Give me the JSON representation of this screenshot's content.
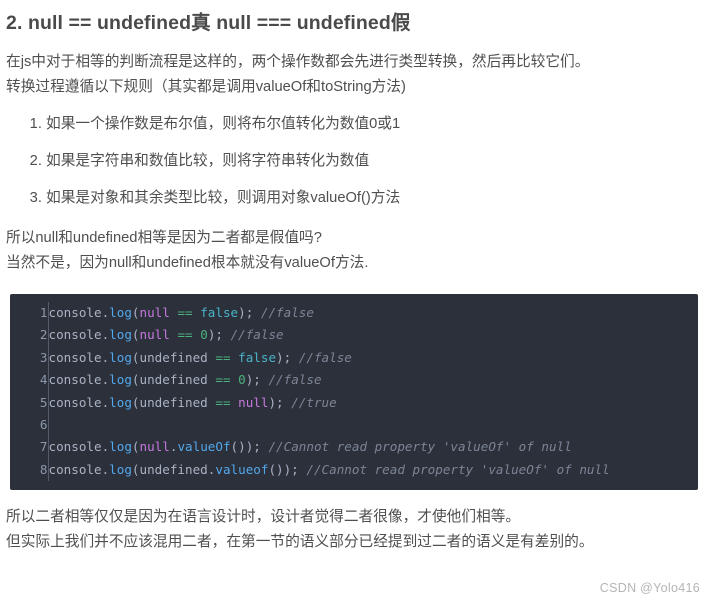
{
  "article": {
    "title": "2. null == undefined真 null === undefined假",
    "intro": [
      "在js中对于相等的判断流程是这样的，两个操作数都会先进行类型转换，然后再比较它们。",
      "转换过程遵循以下规则（其实都是调用valueOf和toString方法)"
    ],
    "rules": [
      "如果一个操作数是布尔值，则将布尔值转化为数值0或1",
      "如果是字符串和数值比较，则将字符串转化为数值",
      "如果是对象和其余类型比较，则调用对象valueOf()方法"
    ],
    "midtext": [
      "所以null和undefined相等是因为二者都是假值吗?",
      "当然不是，因为null和undefined根本就没有valueOf方法."
    ],
    "outro": [
      "所以二者相等仅仅是因为在语言设计时，设计者觉得二者很像，才使他们相等。",
      "但实际上我们并不应该混用二者，在第一节的语义部分已经提到过二者的语义是有差别的。"
    ]
  },
  "code_block": {
    "language": "javascript",
    "line_numbers": [
      "1",
      "2",
      "3",
      "4",
      "5",
      "6",
      "7",
      "8"
    ],
    "lines": [
      "console.log(null == false); //false",
      "console.log(null == 0); //false",
      "console.log(undefined == false); //false",
      "console.log(undefined == 0); //false",
      "console.log(undefined == null); //true",
      "",
      "console.log(null.valueOf()); //Cannot read property 'valueOf' of null",
      "console.log(undefined.valueof()); //Cannot read property 'valueOf' of null"
    ],
    "tokens": [
      [
        {
          "t": "console",
          "c": "t-plain"
        },
        {
          "t": ".",
          "c": "t-punc"
        },
        {
          "t": "log",
          "c": "t-fn"
        },
        {
          "t": "(",
          "c": "t-punc"
        },
        {
          "t": "null",
          "c": "t-kw"
        },
        {
          "t": " ",
          "c": "t-plain"
        },
        {
          "t": "==",
          "c": "t-op"
        },
        {
          "t": " ",
          "c": "t-plain"
        },
        {
          "t": "false",
          "c": "t-bool"
        },
        {
          "t": "); ",
          "c": "t-punc"
        },
        {
          "t": "//false",
          "c": "t-com"
        }
      ],
      [
        {
          "t": "console",
          "c": "t-plain"
        },
        {
          "t": ".",
          "c": "t-punc"
        },
        {
          "t": "log",
          "c": "t-fn"
        },
        {
          "t": "(",
          "c": "t-punc"
        },
        {
          "t": "null",
          "c": "t-kw"
        },
        {
          "t": " ",
          "c": "t-plain"
        },
        {
          "t": "==",
          "c": "t-op"
        },
        {
          "t": " ",
          "c": "t-plain"
        },
        {
          "t": "0",
          "c": "t-num"
        },
        {
          "t": "); ",
          "c": "t-punc"
        },
        {
          "t": "//false",
          "c": "t-com"
        }
      ],
      [
        {
          "t": "console",
          "c": "t-plain"
        },
        {
          "t": ".",
          "c": "t-punc"
        },
        {
          "t": "log",
          "c": "t-fn"
        },
        {
          "t": "(",
          "c": "t-punc"
        },
        {
          "t": "undefined",
          "c": "t-plain"
        },
        {
          "t": " ",
          "c": "t-plain"
        },
        {
          "t": "==",
          "c": "t-op"
        },
        {
          "t": " ",
          "c": "t-plain"
        },
        {
          "t": "false",
          "c": "t-bool"
        },
        {
          "t": "); ",
          "c": "t-punc"
        },
        {
          "t": "//false",
          "c": "t-com"
        }
      ],
      [
        {
          "t": "console",
          "c": "t-plain"
        },
        {
          "t": ".",
          "c": "t-punc"
        },
        {
          "t": "log",
          "c": "t-fn"
        },
        {
          "t": "(",
          "c": "t-punc"
        },
        {
          "t": "undefined",
          "c": "t-plain"
        },
        {
          "t": " ",
          "c": "t-plain"
        },
        {
          "t": "==",
          "c": "t-op"
        },
        {
          "t": " ",
          "c": "t-plain"
        },
        {
          "t": "0",
          "c": "t-num"
        },
        {
          "t": "); ",
          "c": "t-punc"
        },
        {
          "t": "//false",
          "c": "t-com"
        }
      ],
      [
        {
          "t": "console",
          "c": "t-plain"
        },
        {
          "t": ".",
          "c": "t-punc"
        },
        {
          "t": "log",
          "c": "t-fn"
        },
        {
          "t": "(",
          "c": "t-punc"
        },
        {
          "t": "undefined",
          "c": "t-plain"
        },
        {
          "t": " ",
          "c": "t-plain"
        },
        {
          "t": "==",
          "c": "t-op"
        },
        {
          "t": " ",
          "c": "t-plain"
        },
        {
          "t": "null",
          "c": "t-kw"
        },
        {
          "t": "); ",
          "c": "t-punc"
        },
        {
          "t": "//true",
          "c": "t-com"
        }
      ],
      [],
      [
        {
          "t": "console",
          "c": "t-plain"
        },
        {
          "t": ".",
          "c": "t-punc"
        },
        {
          "t": "log",
          "c": "t-fn"
        },
        {
          "t": "(",
          "c": "t-punc"
        },
        {
          "t": "null",
          "c": "t-kw"
        },
        {
          "t": ".",
          "c": "t-punc"
        },
        {
          "t": "valueOf",
          "c": "t-fn"
        },
        {
          "t": "()); ",
          "c": "t-punc"
        },
        {
          "t": "//Cannot read property 'valueOf' of null",
          "c": "t-com"
        }
      ],
      [
        {
          "t": "console",
          "c": "t-plain"
        },
        {
          "t": ".",
          "c": "t-punc"
        },
        {
          "t": "log",
          "c": "t-fn"
        },
        {
          "t": "(",
          "c": "t-punc"
        },
        {
          "t": "undefined",
          "c": "t-plain"
        },
        {
          "t": ".",
          "c": "t-punc"
        },
        {
          "t": "valueof",
          "c": "t-fn"
        },
        {
          "t": "()); ",
          "c": "t-punc"
        },
        {
          "t": "//Cannot read property 'valueOf' of null",
          "c": "t-com"
        }
      ]
    ]
  },
  "watermark": {
    "text": "CSDN @Yolo416"
  },
  "colors": {
    "code_background": "#2b303b",
    "gutter_text": "#8d98a8",
    "gutter_separator": "#545b6a",
    "token_plain": "#a9b2c3",
    "token_function": "#52a8ec",
    "token_keyword": "#c679dd",
    "token_operator": "#4cb17c",
    "token_number": "#4cb17c",
    "token_boolean": "#4ab3c8",
    "token_comment": "#7c8595",
    "body_text": "#4f4f4f",
    "title_text": "#4a4a4a",
    "watermark_text": "#b5b5b5",
    "page_background": "#ffffff"
  }
}
